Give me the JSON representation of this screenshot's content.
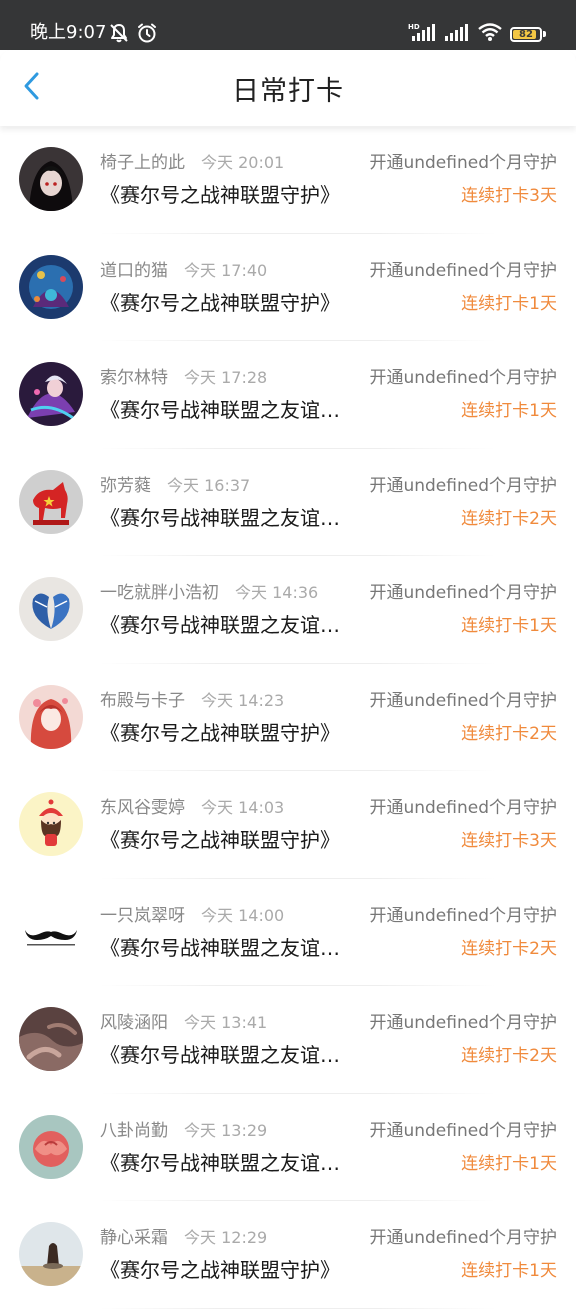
{
  "status_bar": {
    "time": "晚上9:07",
    "battery": "82",
    "icons": [
      "mute-icon",
      "alarm-icon",
      "hd-signal-icon",
      "signal-icon",
      "wifi-icon",
      "battery-icon"
    ]
  },
  "header": {
    "title": "日常打卡",
    "back_icon": "chevron-left-icon"
  },
  "colors": {
    "accent": "#2f9ae0",
    "streak": "#f08a3c",
    "status_bar_bg": "#353637",
    "battery_fill": "#f3c744"
  },
  "checkins": [
    {
      "name": "椅子上的此",
      "time": "今天 20:01",
      "desc": "开通undefined个月守护",
      "game": "《赛尔号之战神联盟守护》",
      "streak": "连续打卡3天"
    },
    {
      "name": "道口的猫",
      "time": "今天 17:40",
      "desc": "开通undefined个月守护",
      "game": "《赛尔号之战神联盟守护》",
      "streak": "连续打卡1天"
    },
    {
      "name": "索尔林特",
      "time": "今天 17:28",
      "desc": "开通undefined个月守护",
      "game": "《赛尔号战神联盟之友谊…",
      "streak": "连续打卡1天"
    },
    {
      "name": "弥芳蕤",
      "time": "今天 16:37",
      "desc": "开通undefined个月守护",
      "game": "《赛尔号战神联盟之友谊…",
      "streak": "连续打卡2天"
    },
    {
      "name": "一吃就胖小浩初",
      "time": "今天 14:36",
      "desc": "开通undefined个月守护",
      "game": "《赛尔号战神联盟之友谊…",
      "streak": "连续打卡1天"
    },
    {
      "name": "布殿与卡子",
      "time": "今天 14:23",
      "desc": "开通undefined个月守护",
      "game": "《赛尔号之战神联盟守护》",
      "streak": "连续打卡2天"
    },
    {
      "name": "东风谷雯婷",
      "time": "今天 14:03",
      "desc": "开通undefined个月守护",
      "game": "《赛尔号之战神联盟守护》",
      "streak": "连续打卡3天"
    },
    {
      "name": "一只岚翠呀",
      "time": "今天 14:00",
      "desc": "开通undefined个月守护",
      "game": "《赛尔号战神联盟之友谊…",
      "streak": "连续打卡2天"
    },
    {
      "name": "风陵涵阳",
      "time": "今天 13:41",
      "desc": "开通undefined个月守护",
      "game": "《赛尔号战神联盟之友谊…",
      "streak": "连续打卡2天"
    },
    {
      "name": "八卦尚勤",
      "time": "今天 13:29",
      "desc": "开通undefined个月守护",
      "game": "《赛尔号战神联盟之友谊…",
      "streak": "连续打卡1天"
    },
    {
      "name": "静心采霜",
      "time": "今天 12:29",
      "desc": "开通undefined个月守护",
      "game": "《赛尔号之战神联盟守护》",
      "streak": "连续打卡1天"
    }
  ]
}
